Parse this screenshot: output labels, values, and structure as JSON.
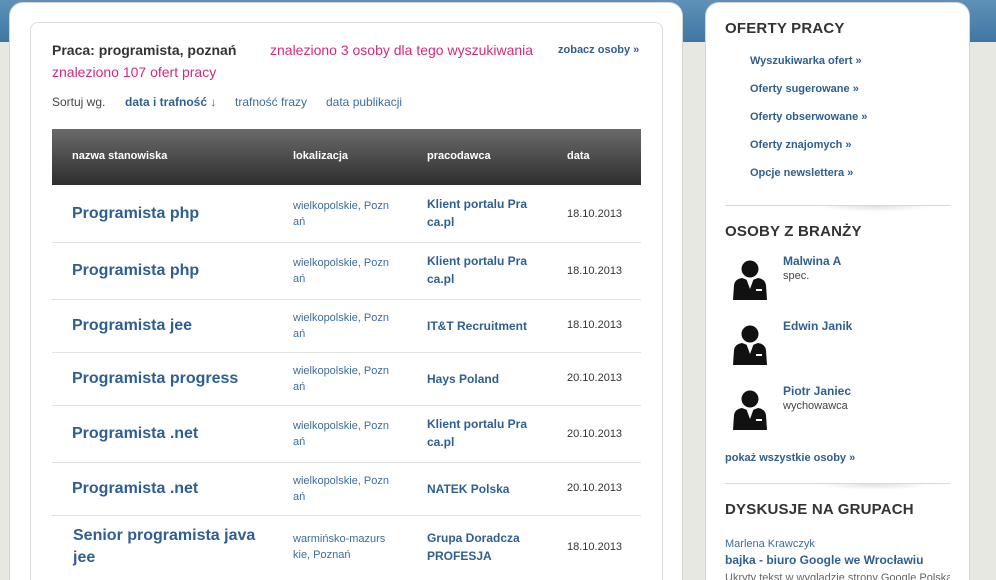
{
  "search": {
    "title": "Praca: programista, poznań",
    "found_people": "znaleziono 3 osoby dla tego wyszukiwania",
    "see_people": "zobacz osoby »",
    "found_offers": "znaleziono 107 ofert pracy"
  },
  "sort": {
    "label": "Sortuj wg.",
    "active": "data i trafność ↓",
    "options": [
      "trafność frazy",
      "data publikacji"
    ]
  },
  "table": {
    "headers": [
      "nazwa stanowiska",
      "lokalizacja",
      "pracodawca",
      "data"
    ],
    "rows": [
      {
        "title": "Programista php",
        "location": "wielkopolskie, Pozn ań",
        "employer": "Klient portalu Pra ca.pl",
        "date": "18.10.2013"
      },
      {
        "title": "Programista php",
        "location": "wielkopolskie, Pozn ań",
        "employer": "Klient portalu Pra ca.pl",
        "date": "18.10.2013"
      },
      {
        "title": "Programista jee",
        "location": "wielkopolskie, Pozn ań",
        "employer": "IT&T Recruitment",
        "date": "18.10.2013"
      },
      {
        "title": "Programista progress",
        "location": "wielkopolskie, Pozn ań",
        "employer": "Hays Poland",
        "date": "20.10.2013"
      },
      {
        "title": "Programista .net",
        "location": "wielkopolskie, Pozn ań",
        "employer": "Klient portalu Pra ca.pl",
        "date": "20.10.2013"
      },
      {
        "title": "Programista .net",
        "location": "wielkopolskie, Pozn ań",
        "employer": "NATEK Polska",
        "date": "20.10.2013"
      },
      {
        "title": "Senior programista java jee",
        "location": "warmińsko-mazurs kie, Poznań",
        "employer": "Grupa Doradcza PROFESJA",
        "date": "18.10.2013"
      }
    ]
  },
  "sidebar": {
    "offers_heading": "OFERTY PRACY",
    "offers_links": [
      "Wyszukiwarka ofert »",
      "Oferty sugerowane »",
      "Oferty obserwowane »",
      "Oferty znajomych »",
      "Opcje newslettera »"
    ],
    "people_heading": "OSOBY Z BRANŻY",
    "people": [
      {
        "name": "Malwina A",
        "role": "spec."
      },
      {
        "name": "Edwin Janik",
        "role": ""
      },
      {
        "name": "Piotr Janiec",
        "role": "wychowawca"
      }
    ],
    "show_all_people": "pokaż wszystkie osoby »",
    "groups_heading": "DYSKUSJE NA GRUPACH",
    "discussion": {
      "author": "Marlena Krawczyk",
      "title": "bajka - biuro Google we Wrocławiu",
      "excerpt": "Ukryty tekst w wyglądzie strony Google Polska"
    }
  }
}
